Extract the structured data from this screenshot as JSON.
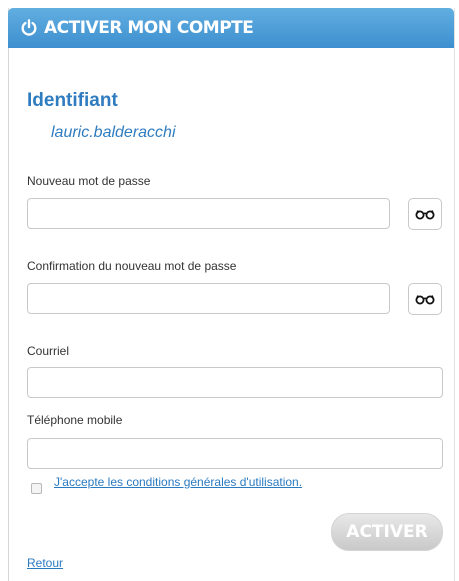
{
  "header": {
    "title": "ACTIVER MON COMPTE",
    "icon": "power-icon"
  },
  "identity": {
    "label": "Identifiant",
    "value": "lauric.balderacchi"
  },
  "fields": {
    "new_password": {
      "label": "Nouveau mot de passe",
      "value": ""
    },
    "confirm_password": {
      "label": "Confirmation du nouveau mot de passe",
      "value": ""
    },
    "email": {
      "label": "Courriel",
      "value": ""
    },
    "mobile": {
      "label": "Téléphone mobile",
      "value": ""
    }
  },
  "terms": {
    "label": "J'accepte les conditions générales d'utilisation.",
    "checked": false
  },
  "actions": {
    "activate_label": "ACTIVER",
    "back_label": "Retour"
  },
  "colors": {
    "header": "#4a9ad8",
    "accent": "#2f7cc0",
    "link": "#2a7ac0",
    "button_disabled": "#d3d3d3"
  }
}
